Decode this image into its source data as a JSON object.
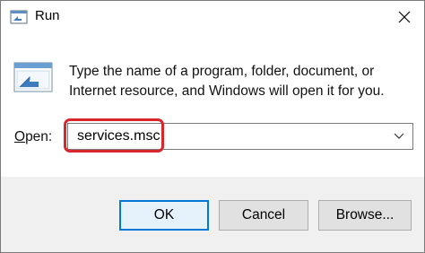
{
  "window": {
    "title": "Run"
  },
  "content": {
    "description": "Type the name of a program, folder, document, or Internet resource, and Windows will open it for you.",
    "open_label_accel": "O",
    "open_label_rest": "pen:",
    "open_value": "services.msc"
  },
  "buttons": {
    "ok": "OK",
    "cancel": "Cancel",
    "browse": "Browse..."
  },
  "colors": {
    "highlight": "#d9262c",
    "ok_border": "#0078d7"
  }
}
